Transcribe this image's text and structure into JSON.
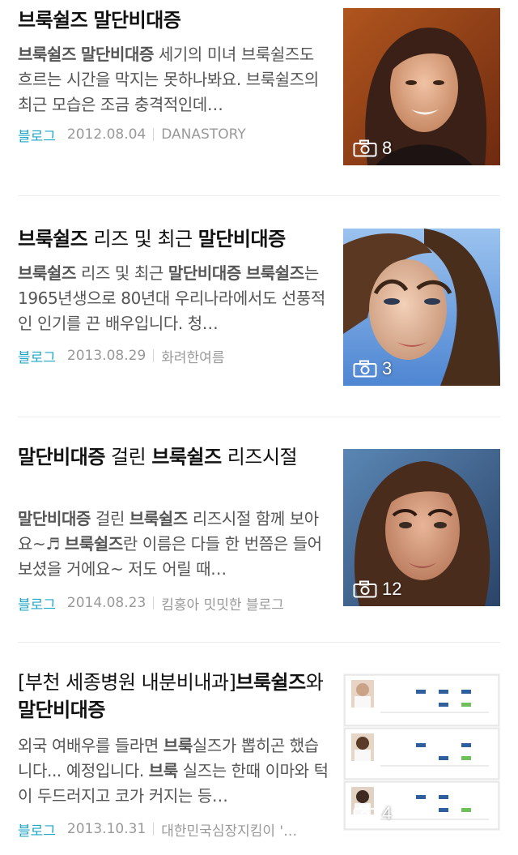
{
  "results": [
    {
      "title_html": "<b>브룩쉴즈</b> <b>말단비대증</b>",
      "snippet_html": "<b>브룩쉴즈</b> <b>말단비대증</b> 세기의 미녀 브룩쉴즈도 흐르는 시간을 막지는 못하나봐요. 브룩쉴즈의 최근 모습은 조금 충격적인데…",
      "source": "블로그",
      "date": "2012.08.04",
      "author": "DANASTORY",
      "photo_count": "8",
      "image": "brooke-smiling-photo"
    },
    {
      "title_html": "<b>브룩쉴즈</b> 리즈 및 최근 <b>말단비대증</b>",
      "snippet_html": "<b>브룩쉴즈</b> 리즈 및 최근 <b>말단비대증</b> <b>브룩쉴즈</b>는 1965년생으로 80년대 우리나라에서도 선풍적인 인기를 끈 배우입니다. 청…",
      "source": "블로그",
      "date": "2013.08.29",
      "author": "화려한여름",
      "photo_count": "3",
      "image": "brooke-portrait-photo"
    },
    {
      "title_html": "<b>말단비대증</b> 걸린 <b>브룩쉴즈</b> 리즈시절",
      "snippet_html": "<b>말단비대증</b> 걸린 <b>브룩쉴즈</b> 리즈시절 함께 보아요~♬ <b>브룩쉴즈</b>란 이름은 다들 한 번쯤은 들어 보셨을 거에요~ 저도 어릴 때…",
      "source": "블로그",
      "date": "2014.08.23",
      "author": "킴홍아 밋밋한 블로그",
      "photo_count": "12",
      "image": "brooke-young-photo"
    },
    {
      "title_html": "[부천 세종병원 내분비내과]<b>브룩쉴즈</b>와 <b>말단비대증</b>",
      "snippet_html": "외국 여배우를 들라면 <b>브룩</b>실즈가 뽑히곤 했습니다... 예정입니다. <b>브룩</b> 실즈는 한때 이마와 턱이 두드러지고 코가 커지는 등…",
      "source": "블로그",
      "date": "2013.10.31",
      "author": "대한민국심장지킴이 '…",
      "photo_count": "4",
      "image": "doctor-schedule-table"
    }
  ],
  "colors": {
    "source_link": "#1fa7c6",
    "meta_gray": "#999999",
    "title": "#111111",
    "snippet": "#555555"
  }
}
